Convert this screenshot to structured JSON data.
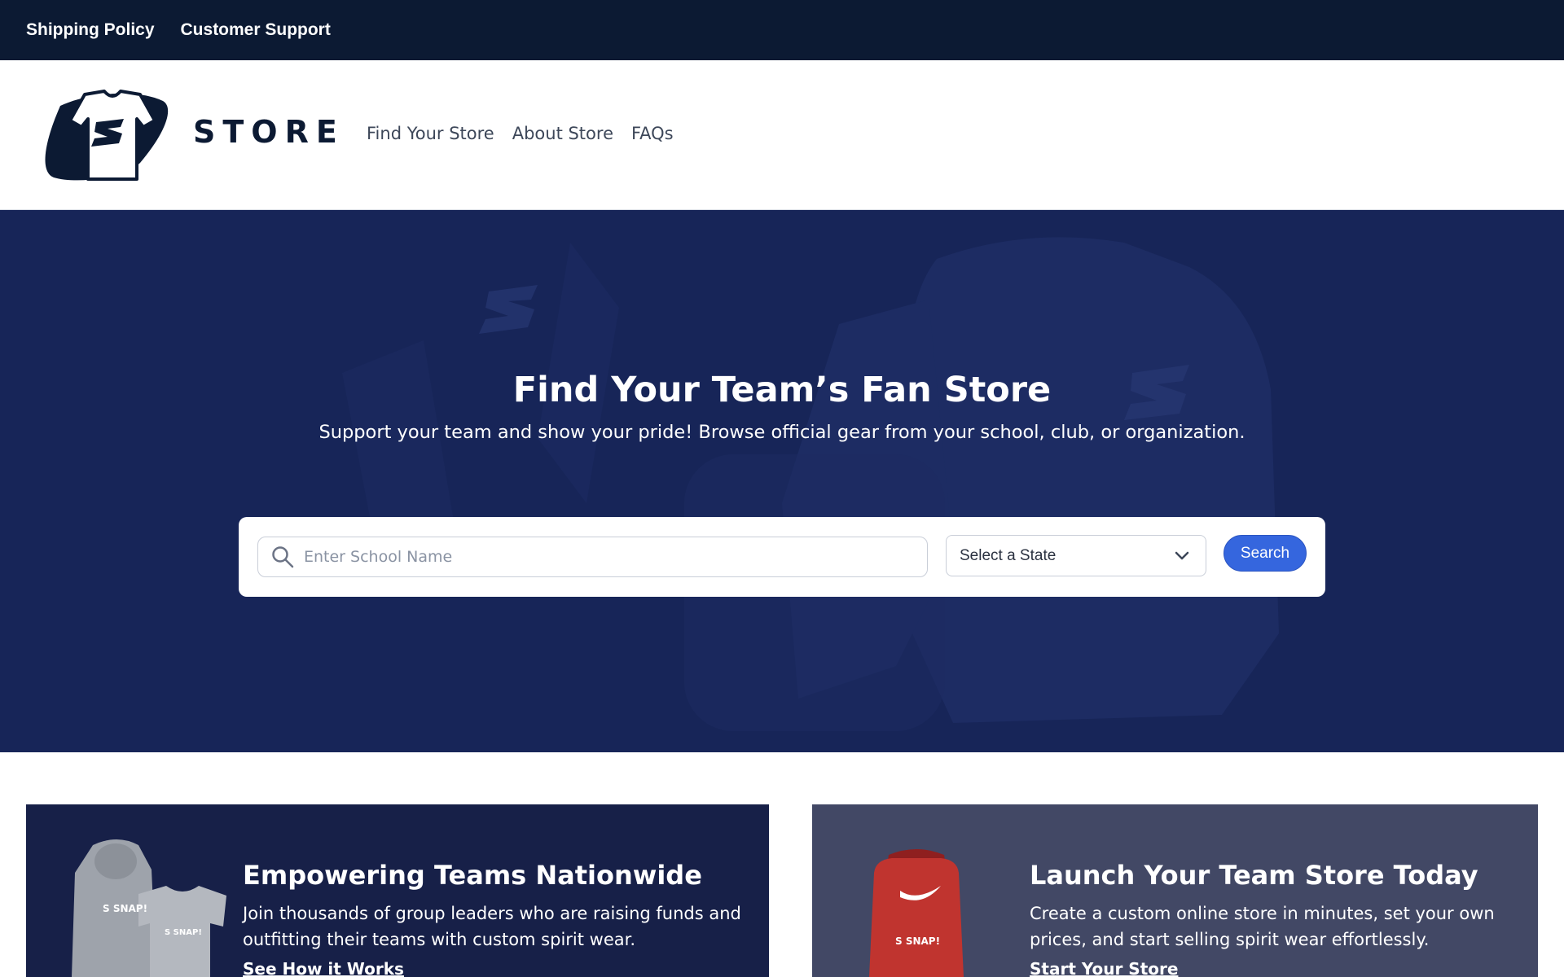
{
  "topbar": {
    "links": [
      "Shipping Policy",
      "Customer Support"
    ]
  },
  "header": {
    "logo_text": "STORE",
    "nav": [
      "Find Your Store",
      "About Store",
      "FAQs"
    ]
  },
  "hero": {
    "title": "Find Your Team’s Fan Store",
    "subtitle": "Support your team and show your pride! Browse official gear from your school, club, or organization.",
    "search": {
      "placeholder": "Enter School Name",
      "value": "",
      "state_selected": "Select a State",
      "button_label": "Search"
    }
  },
  "cards": [
    {
      "title": "Empowering Teams Nationwide",
      "text": "Join thousands of group leaders who are raising funds and outfitting their teams with custom spirit wear.",
      "link": "See How it Works",
      "background": "#172048",
      "image_icon": "hoodie-and-tshirt-image"
    },
    {
      "title": "Launch Your Team Store Today",
      "text": "Create a custom online store in minutes, set your own prices, and start selling spirit wear effortlessly.",
      "link": "Start Your Store",
      "background": "#424865",
      "image_icon": "red-backpack-image"
    }
  ],
  "colors": {
    "topbar": "#0c1a33",
    "hero": "#172558",
    "accent": "#3566de"
  }
}
